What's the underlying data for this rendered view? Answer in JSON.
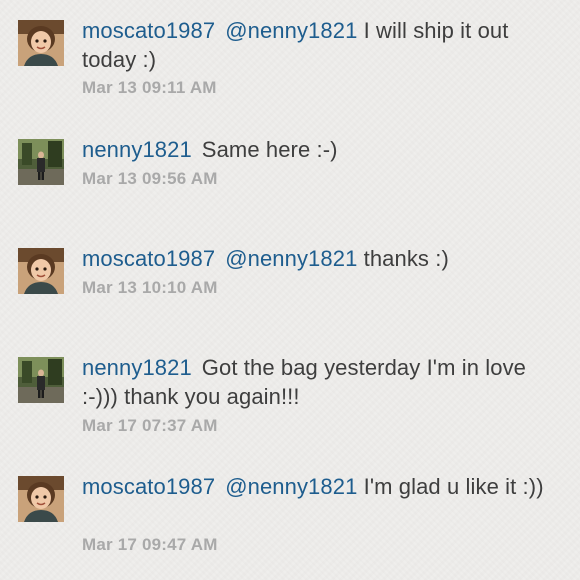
{
  "comments": [
    {
      "avatar_icon": "user-avatar-moscato1987",
      "username": "moscato1987",
      "mention": "@nenny1821",
      "text": " I will ship it out today :)",
      "timestamp": "Mar 13 09:11 AM"
    },
    {
      "avatar_icon": "user-avatar-nenny1821",
      "username": "nenny1821",
      "mention": "",
      "text": "Same here :-)",
      "timestamp": "Mar 13 09:56 AM"
    },
    {
      "avatar_icon": "user-avatar-moscato1987",
      "username": "moscato1987",
      "mention": "@nenny1821",
      "text": " thanks :)",
      "timestamp": "Mar 13 10:10 AM"
    },
    {
      "avatar_icon": "user-avatar-nenny1821",
      "username": "nenny1821",
      "mention": "",
      "text": "Got the bag yesterday I'm in love :-))) thank you again!!!",
      "timestamp": "Mar 17 07:37 AM"
    },
    {
      "avatar_icon": "user-avatar-moscato1987",
      "username": "moscato1987",
      "mention": "@nenny1821",
      "text": " I'm glad u like it :))",
      "timestamp": "Mar 17 09:47 AM"
    }
  ],
  "colors": {
    "username": "#1e5d8e",
    "body_text": "#3e3e3e",
    "timestamp": "#a9a9a9",
    "background": "#efeeec"
  }
}
